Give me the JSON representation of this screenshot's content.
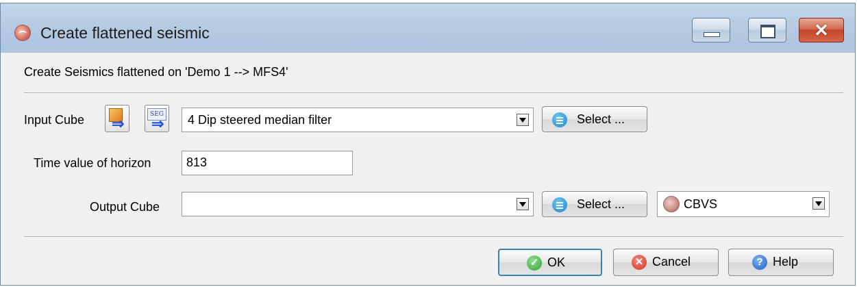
{
  "window": {
    "title": "Create flattened seismic",
    "close_glyph": "✕"
  },
  "info": "Create Seismics flattened on 'Demo 1 --> MFS4'",
  "input_cube": {
    "label": "Input Cube",
    "value": "4 Dip steered median filter",
    "select_label": "Select ...",
    "seg_text": "SEG"
  },
  "time_horizon": {
    "label": "Time value of horizon",
    "value": "813"
  },
  "output_cube": {
    "label": "Output Cube",
    "value": "",
    "select_label": "Select ...",
    "format_value": "CBVS"
  },
  "buttons": {
    "ok": "OK",
    "cancel": "Cancel",
    "help": "Help"
  },
  "icon_glyphs": {
    "ok": "✓",
    "cancel": "✕",
    "help": "?",
    "arrow": "⇒"
  }
}
